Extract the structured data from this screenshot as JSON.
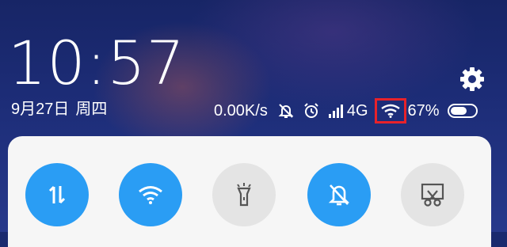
{
  "lockscreen": {
    "time": "10:57",
    "date": "9月27日",
    "weekday": "周四"
  },
  "status_bar": {
    "net_speed": "0.00K/s",
    "network_type": "4G",
    "battery_percent": "67%",
    "battery_level": 0.67,
    "icons": [
      "notifications-muted-icon",
      "alarm-icon",
      "signal-icon",
      "wifi-icon",
      "battery-icon"
    ],
    "highlight_color": "#e8222a"
  },
  "quick_toggles": [
    {
      "name": "mobile-data",
      "icon": "data-arrows-icon",
      "state": "on"
    },
    {
      "name": "wifi",
      "icon": "wifi-icon",
      "state": "on"
    },
    {
      "name": "flashlight",
      "icon": "flashlight-icon",
      "state": "off"
    },
    {
      "name": "silent",
      "icon": "bell-off-icon",
      "state": "on"
    },
    {
      "name": "screenshot",
      "icon": "screenshot-icon",
      "state": "off"
    }
  ],
  "colors": {
    "toggle_on": "#2a9df4",
    "toggle_off": "#e4e4e4",
    "panel": "#f6f6f6"
  }
}
